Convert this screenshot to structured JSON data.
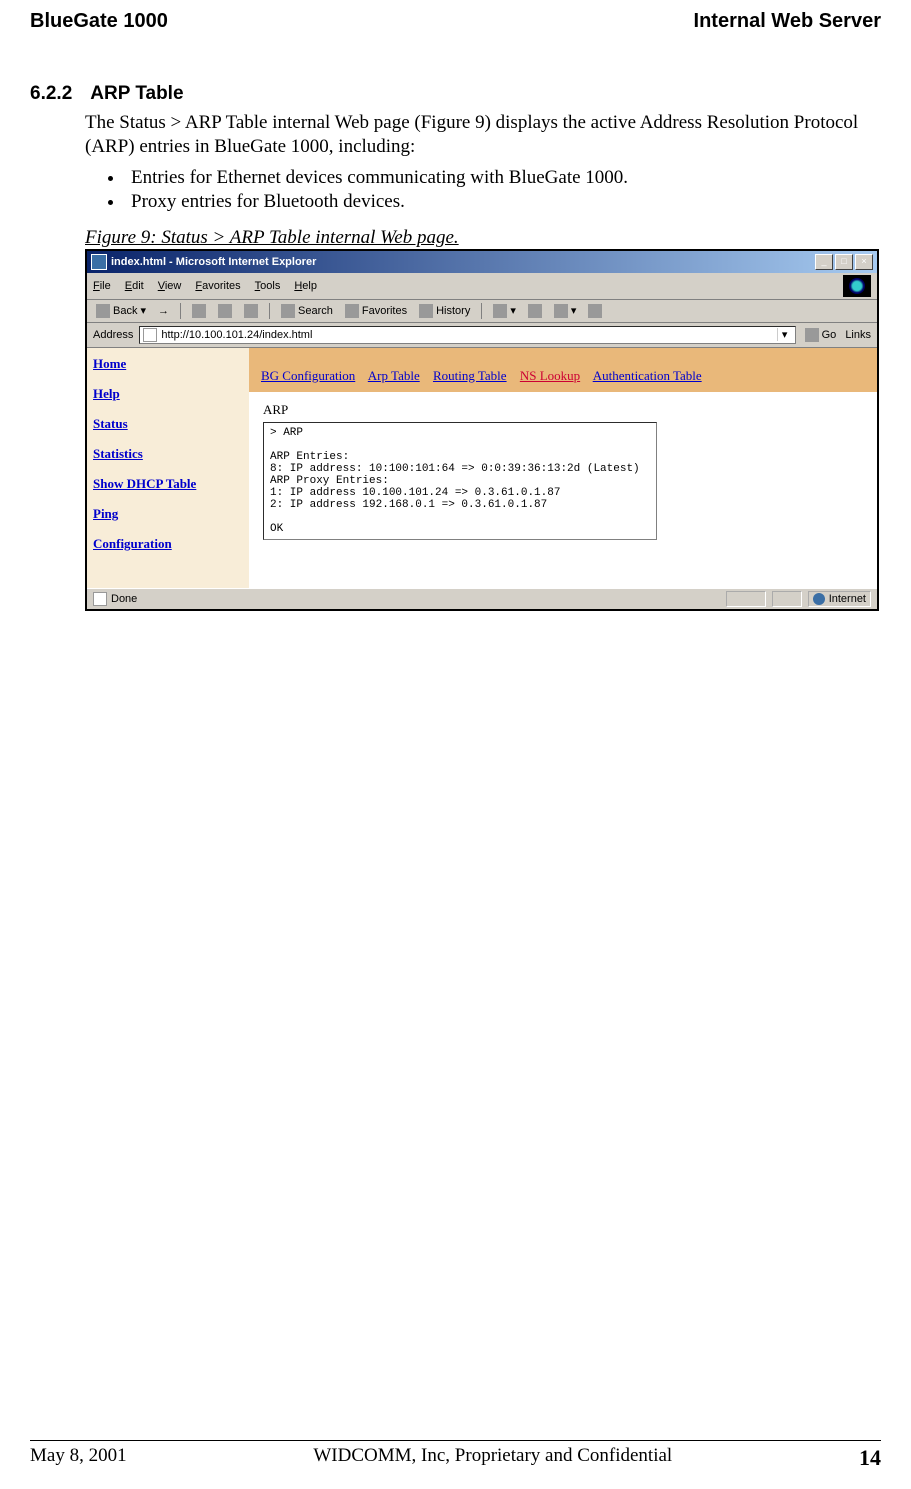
{
  "header": {
    "left": "BlueGate 1000",
    "right": "Internal Web Server"
  },
  "section": {
    "number": "6.2.2",
    "title": "ARP Table"
  },
  "para1": "The Status > ARP Table internal Web page (Figure 9) displays the active Address Resolution Protocol (ARP) entries in BlueGate 1000, including:",
  "bullets": [
    "Entries for Ethernet devices communicating with BlueGate 1000.",
    "Proxy entries for Bluetooth devices."
  ],
  "figure_caption": "Figure 9:  Status > ARP Table internal Web page.",
  "browser": {
    "title": "index.html - Microsoft Internet Explorer",
    "menu": [
      "File",
      "Edit",
      "View",
      "Favorites",
      "Tools",
      "Help"
    ],
    "toolbar": {
      "back": "Back",
      "search": "Search",
      "favorites": "Favorites",
      "history": "History"
    },
    "address_label": "Address",
    "address_value": "http://10.100.101.24/index.html",
    "go": "Go",
    "links": "Links",
    "sidebar": [
      "Home",
      "Help",
      "Status",
      "Statistics",
      "Show DHCP Table",
      "Ping",
      "Configuration"
    ],
    "tabs": [
      "BG Configuration",
      "Arp Table",
      "Routing Table",
      "NS Lookup",
      "Authentication Table"
    ],
    "arp_label": "ARP",
    "terminal": "> ARP\n\nARP Entries:\n8: IP address: 10:100:101:64 => 0:0:39:36:13:2d (Latest)\nARP Proxy Entries:\n1: IP address 10.100.101.24 => 0.3.61.0.1.87\n2: IP address 192.168.0.1 => 0.3.61.0.1.87\n\nOK",
    "status_left": "Done",
    "status_right": "Internet"
  },
  "footer": {
    "left": "May 8, 2001",
    "mid": "WIDCOMM, Inc, Proprietary and Confidential",
    "right": "14"
  }
}
